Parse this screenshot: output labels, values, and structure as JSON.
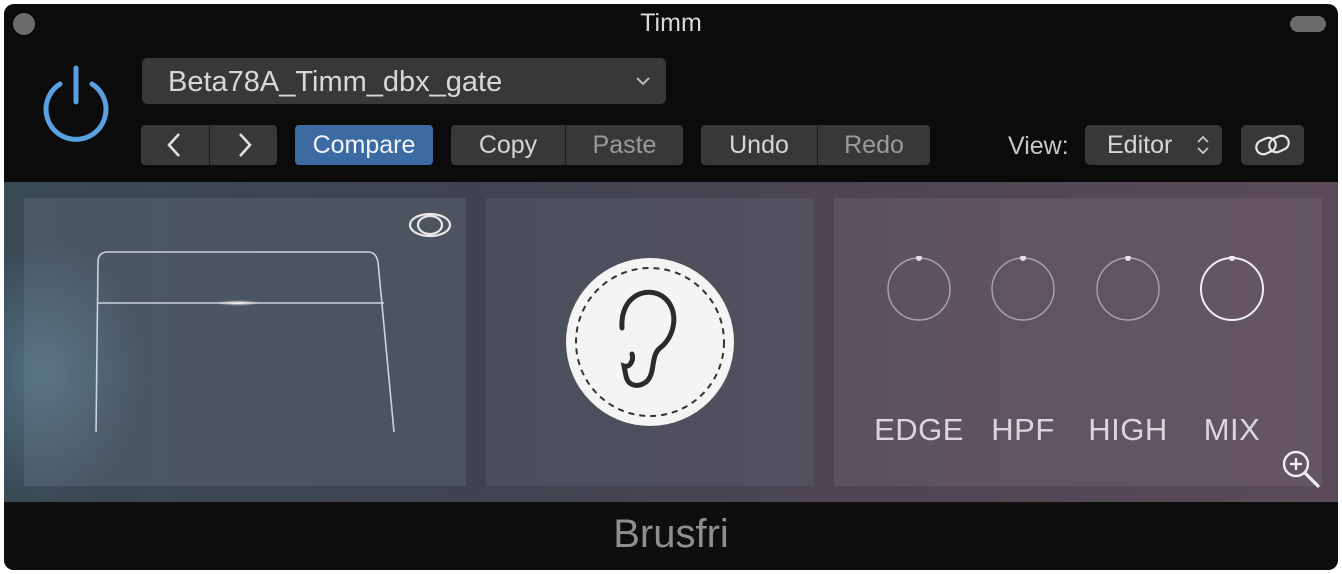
{
  "window": {
    "title": "Timm"
  },
  "header": {
    "preset_name": "Beta78A_Timm_dbx_gate",
    "prev_label": "<",
    "next_label": ">",
    "compare_label": "Compare",
    "copy_label": "Copy",
    "paste_label": "Paste",
    "undo_label": "Undo",
    "redo_label": "Redo",
    "view_label": "View:",
    "view_value": "Editor",
    "icons": [
      "power-icon",
      "chevron-down-icon",
      "updown-icon",
      "link-icon"
    ]
  },
  "plugin": {
    "panels": {
      "gate_icons": [
        "eye-icon"
      ],
      "center_icon": "ear-icon",
      "knobs": [
        {
          "label": "EDGE"
        },
        {
          "label": "HPF"
        },
        {
          "label": "HIGH"
        },
        {
          "label": "MIX"
        }
      ],
      "zoom_icon": "zoom-in-icon"
    }
  },
  "footer": {
    "plugin_name": "Brusfri"
  },
  "colors": {
    "accent_blue": "#3c6aa3",
    "power_blue": "#5aa0e0",
    "background": "#0b0b0c",
    "button": "#38383a"
  }
}
